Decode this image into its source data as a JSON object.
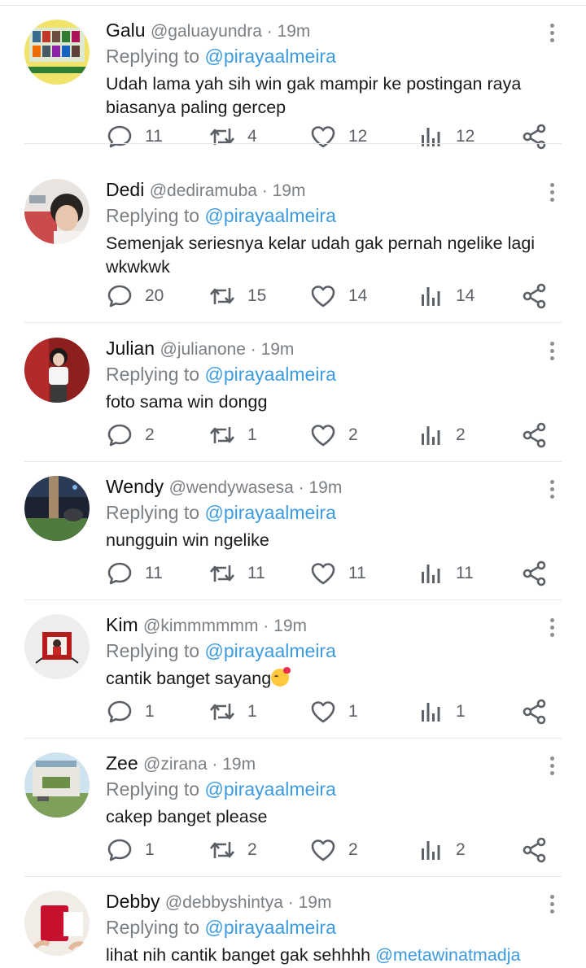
{
  "tweets": [
    {
      "name": "Galu",
      "handle": "@galuayundra",
      "time": "19m",
      "replying_prefix": "Replying to ",
      "replying_to": "@pirayaalmeira",
      "text": "Udah lama yah sih win gak mampir ke postingan raya biasanya paling gercep",
      "replies": "11",
      "retweets": "4",
      "likes": "12",
      "views": "12"
    },
    {
      "name": "Dedi",
      "handle": "@dediramuba",
      "time": "19m",
      "replying_prefix": "Replying to ",
      "replying_to": "@pirayaalmeira",
      "text": "Semenjak seriesnya kelar udah gak pernah ngelike lagi wkwkwk",
      "replies": "20",
      "retweets": "15",
      "likes": "14",
      "views": "14"
    },
    {
      "name": "Julian",
      "handle": "@julianone",
      "time": "19m",
      "replying_prefix": "Replying to ",
      "replying_to": "@pirayaalmeira",
      "text": "foto sama win dongg",
      "replies": "2",
      "retweets": "1",
      "likes": "2",
      "views": "2"
    },
    {
      "name": "Wendy",
      "handle": "@wendywasesa",
      "time": "19m",
      "replying_prefix": "Replying to ",
      "replying_to": "@pirayaalmeira",
      "text": "nungguin win ngelike",
      "replies": "11",
      "retweets": "11",
      "likes": "11",
      "views": "11"
    },
    {
      "name": "Kim",
      "handle": "@kimmmmmm",
      "time": "19m",
      "replying_prefix": "Replying to ",
      "replying_to": "@pirayaalmeira",
      "text": "cantik banget sayang",
      "replies": "1",
      "retweets": "1",
      "likes": "1",
      "views": "1"
    },
    {
      "name": "Zee",
      "handle": "@zirana",
      "time": "19m",
      "replying_prefix": "Replying to ",
      "replying_to": "@pirayaalmeira",
      "text": "cakep banget please",
      "replies": "1",
      "retweets": "2",
      "likes": "2",
      "views": "2"
    },
    {
      "name": "Debby",
      "handle": "@debbyshintya",
      "time": "19m",
      "replying_prefix": "Replying to ",
      "replying_to": "@pirayaalmeira",
      "text": "lihat nih cantik banget gak sehhhh ",
      "text_mention": "@metawinatmadja"
    }
  ],
  "separator": " · ",
  "icons": {
    "reply": "reply-icon",
    "retweet": "retweet-icon",
    "like": "heart-icon",
    "views": "views-icon",
    "share": "share-icon",
    "more": "more-options-icon"
  },
  "colors": {
    "link": "#3d9be0",
    "muted": "#7a7f84",
    "icon": "#5b6066"
  }
}
